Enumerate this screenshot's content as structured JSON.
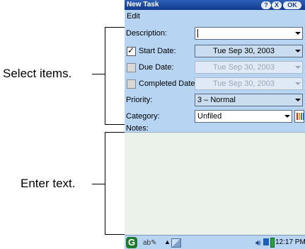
{
  "callouts": {
    "select_items": "Select items.",
    "enter_text": "Enter text."
  },
  "window": {
    "title": "New Task",
    "help_label": "?",
    "close_label": "X",
    "ok_label": "OK"
  },
  "menu": {
    "edit": "Edit"
  },
  "form": {
    "description_label": "Description:",
    "description_value": "",
    "start_date": {
      "label": "Start Date:",
      "checked": true,
      "value": "Tue Sep 30, 2003"
    },
    "due_date": {
      "label": "Due Date:",
      "checked": false,
      "value": "Tue Sep 30, 2003"
    },
    "completed_date": {
      "label": "Completed Date:",
      "checked": false,
      "value": "Tue Sep 30, 2003"
    },
    "priority": {
      "label": "Priority:",
      "value": "3 – Normal"
    },
    "category": {
      "label": "Category:",
      "value": "Unfiled"
    },
    "notes_label": "Notes:"
  },
  "taskbar": {
    "start_icon": "G",
    "clock": "12:17 PM"
  },
  "icons": [
    "help-icon",
    "close-icon",
    "dropdown-arrow-icon",
    "checkbox-icon",
    "color-picker-icon",
    "start-menu-icon",
    "handwriting-icon",
    "input-method-up-icon",
    "keyboard-icon",
    "speaker-icon",
    "network-icon",
    "battery-icon"
  ]
}
